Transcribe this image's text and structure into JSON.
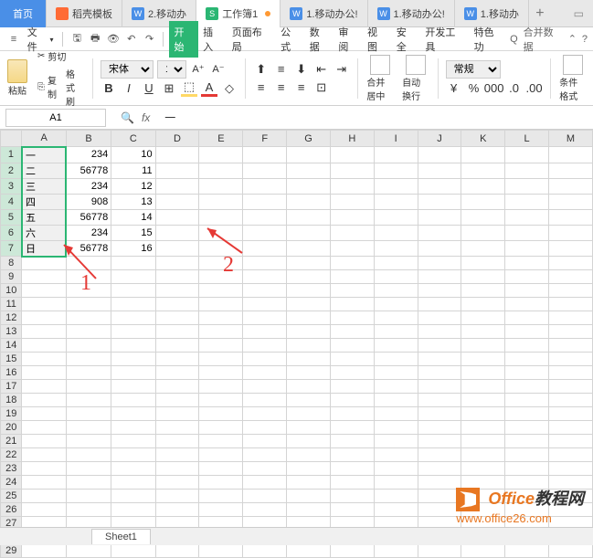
{
  "tabs": {
    "home": "首页",
    "t1": "稻壳模板",
    "t2": "2.移动办",
    "t3": "工作簿1",
    "t4": "1.移动办公!",
    "t5": "1.移动办公!",
    "t6": "1.移动办"
  },
  "file_menu": "文件",
  "ribbon_tabs": {
    "start": "开始",
    "insert": "插入",
    "layout": "页面布局",
    "formula": "公式",
    "data": "数据",
    "review": "审阅",
    "view": "视图",
    "security": "安全",
    "dev": "开发工具",
    "special": "特色功"
  },
  "search": {
    "label": "合并数据",
    "icon": "Q"
  },
  "toolbar": {
    "paste": "粘贴",
    "cut": "剪切",
    "copy": "复制",
    "format_painter": "格式刷",
    "font_name": "宋体",
    "font_size": "11",
    "merge": "合并居中",
    "wrap": "自动换行",
    "general": "常规",
    "cond_fmt": "条件格式"
  },
  "namebox": "A1",
  "fx_content": "一",
  "columns": [
    "A",
    "B",
    "C",
    "D",
    "E",
    "F",
    "G",
    "H",
    "I",
    "J",
    "K",
    "L",
    "M"
  ],
  "rows": 29,
  "data_rows": [
    {
      "a": "一",
      "b": "234",
      "c": "10"
    },
    {
      "a": "二",
      "b": "56778",
      "c": "11"
    },
    {
      "a": "三",
      "b": "234",
      "c": "12"
    },
    {
      "a": "四",
      "b": "908",
      "c": "13"
    },
    {
      "a": "五",
      "b": "56778",
      "c": "14"
    },
    {
      "a": "六",
      "b": "234",
      "c": "15"
    },
    {
      "a": "日",
      "b": "56778",
      "c": "16"
    }
  ],
  "annotations": {
    "label1": "1",
    "label2": "2"
  },
  "sheet_tab": "Sheet1",
  "watermark": {
    "brand1": "Office",
    "brand2": "教程网",
    "url": "www.office26.com"
  }
}
